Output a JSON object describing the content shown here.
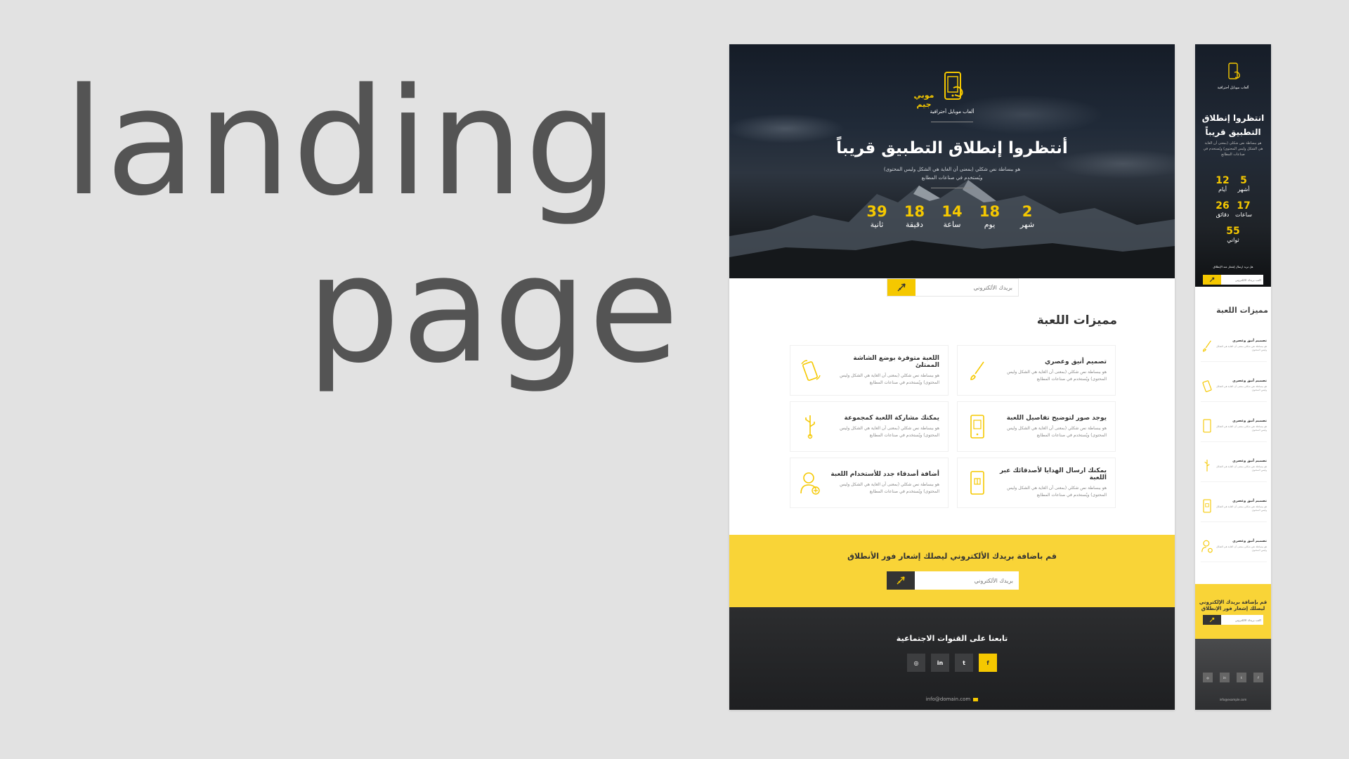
{
  "headline": {
    "line1": "landing",
    "line2": "page"
  },
  "desktop": {
    "logo": {
      "name": "موبي جيم",
      "sub": "ألعاب موبايل أحترافية"
    },
    "hero": {
      "title": "أنتظروا إنطلاق التطبيق قريباً",
      "desc": "هو ببساطة نص شكلي (بمعنى أن الغاية هي الشكل وليس المحتوى) ويُستخدم في صناعات المطابع"
    },
    "countdown": [
      {
        "value": "2",
        "label": "شهر"
      },
      {
        "value": "18",
        "label": "يوم"
      },
      {
        "value": "14",
        "label": "ساعة"
      },
      {
        "value": "18",
        "label": "دقيقة"
      },
      {
        "value": "39",
        "label": "ثانية"
      }
    ],
    "email_placeholder": "بريدك الألكتروني",
    "features_title": "مميزات اللعبة",
    "features": [
      {
        "title": "تصميم أنيق وعصري",
        "desc": "هو ببساطة نص شكلي (بمعنى أن الغاية هي الشكل وليس المحتوى) ويُستخدم في صناعات المطابع",
        "icon": "brush-icon"
      },
      {
        "title": "اللعبة متوفرة بوضع الشاشة الممتلئ",
        "desc": "هو ببساطة نص شكلي (بمعنى أن الغاية هي الشكل وليس المحتوى) ويُستخدم في صناعات المطابع",
        "icon": "phone-rotate-icon"
      },
      {
        "title": "يوجد صور لتوضيح تفاصيل اللعبة",
        "desc": "هو ببساطة نص شكلي (بمعنى أن الغاية هي الشكل وليس المحتوى) ويُستخدم في صناعات المطابع",
        "icon": "phone-image-icon"
      },
      {
        "title": "يمكنك مشاركة اللعبة كمجموعة",
        "desc": "هو ببساطة نص شكلي (بمعنى أن الغاية هي الشكل وليس المحتوى) ويُستخدم في صناعات المطابع",
        "icon": "usb-share-icon"
      },
      {
        "title": "يمكنك ارسال الهدايا لأصدقائك عبر اللعبة",
        "desc": "هو ببساطة نص شكلي (بمعنى أن الغاية هي الشكل وليس المحتوى) ويُستخدم في صناعات المطابع",
        "icon": "phone-gift-icon"
      },
      {
        "title": "أضافة أصدقاء جدد للأستخدام اللعبة",
        "desc": "هو ببساطة نص شكلي (بمعنى أن الغاية هي الشكل وليس المحتوى) ويُستخدم في صناعات المطابع",
        "icon": "add-user-icon"
      }
    ],
    "subscribe_text": "قم باضافة بريدك الألكتروني ليصلك إشعار فور الأنطلاق",
    "follow_title": "تابعنا على القنوات الاجتماعية",
    "socials": [
      {
        "name": "instagram",
        "glyph": "◎"
      },
      {
        "name": "linkedin",
        "glyph": "in"
      },
      {
        "name": "twitter",
        "glyph": "t"
      },
      {
        "name": "facebook",
        "glyph": "f"
      }
    ],
    "footer_email": "info@domain.com"
  },
  "mobile": {
    "logo_sub": "ألعاب موبايل أحترافية",
    "title": "انتظروا إنطلاق التطبيق قريباً",
    "desc": "هو ببساطة نص شكلي (بمعنى أن الغاية هي الشكل وليس المحتوى) ويُستخدم في صناعات المطابع",
    "countdown": [
      {
        "value": "5",
        "label": "أشهر"
      },
      {
        "value": "12",
        "label": "أيام"
      },
      {
        "value": "17",
        "label": "ساعات"
      },
      {
        "value": "26",
        "label": "دقائق"
      },
      {
        "value": "55",
        "label": "ثواني"
      }
    ],
    "note": "هل تريد ارسال إشعار عند الإنطلاق",
    "email_placeholder": "اكتب بريدك الالكتروني",
    "features_title": "مميزات اللعبة",
    "features": [
      {
        "title": "تصميم أنيق وعصري",
        "desc": "هو ببساطة نص شكلي بمعنى أن الغاية هي الشكل وليس المحتوى",
        "icon": "brush-icon"
      },
      {
        "title": "تصميم أنيق وعصري",
        "desc": "هو ببساطة نص شكلي بمعنى أن الغاية هي الشكل وليس المحتوى",
        "icon": "phone-rotate-icon"
      },
      {
        "title": "تصميم أنيق وعصري",
        "desc": "هو ببساطة نص شكلي بمعنى أن الغاية هي الشكل وليس المحتوى",
        "icon": "phone-image-icon"
      },
      {
        "title": "تصميم أنيق وعصري",
        "desc": "هو ببساطة نص شكلي بمعنى أن الغاية هي الشكل وليس المحتوى",
        "icon": "usb-share-icon"
      },
      {
        "title": "تصميم أنيق وعصري",
        "desc": "هو ببساطة نص شكلي بمعنى أن الغاية هي الشكل وليس المحتوى",
        "icon": "phone-gift-icon"
      },
      {
        "title": "تصميم أنيق وعصري",
        "desc": "هو ببساطة نص شكلي بمعنى أن الغاية هي الشكل وليس المحتوى",
        "icon": "add-user-icon"
      }
    ],
    "subscribe_text": "قم بإضافة بريدك الإلكتروني ليصلك إشعار فور الإنطلاق",
    "footer_email": "info@example.com"
  },
  "colors": {
    "accent": "#f5c800",
    "subscribe_bg": "#f9d437",
    "dark": "#333333"
  }
}
